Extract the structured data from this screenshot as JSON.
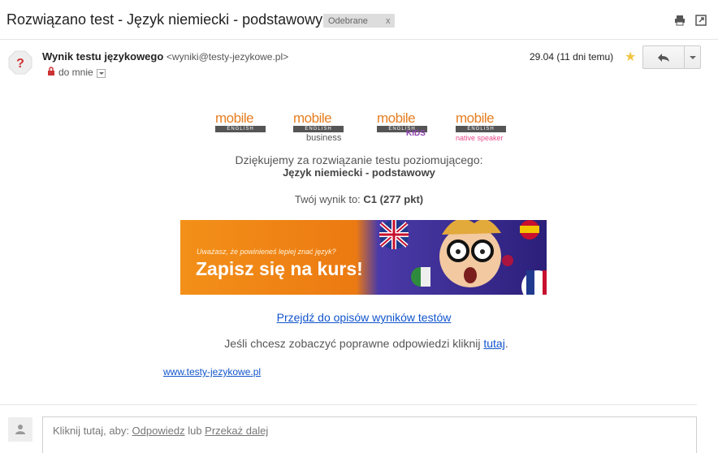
{
  "subject": "Rozwiązano test - Język niemiecki - podstawowy",
  "label": {
    "text": "Odebrane",
    "close": "x"
  },
  "icons": {
    "print": "print-icon",
    "popout": "new-window-icon",
    "avatar": "unknown-sender-icon",
    "lock": "lock-icon",
    "reply": "reply-arrow-icon",
    "star": "star-icon",
    "person": "person-icon"
  },
  "sender": {
    "name": "Wynik testu językowego",
    "email": "<wyniki@testy-jezykowe.pl>"
  },
  "recipient": {
    "text": "do mnie"
  },
  "date": "29.04 (11 dni temu)",
  "logos": [
    {
      "main": "mobile",
      "bar": "ENGLISH",
      "sub": ""
    },
    {
      "main": "mobile",
      "bar": "ENGLISH",
      "sub": "business"
    },
    {
      "main": "mobile",
      "bar": "ENGLISH",
      "sub": "KIDS"
    },
    {
      "main": "mobile",
      "bar": "ENGLISH",
      "sub": "native speaker"
    }
  ],
  "body": {
    "thanks": "Dziękujemy za rozwiązanie testu poziomującego:",
    "test_name": "Język niemiecki - podstawowy",
    "result_prefix": "Twój wynik to: ",
    "result_value": "C1 (277 pkt)",
    "banner_small": "Uważasz, że powinieneś lepiej znać język?",
    "banner_big": "Zapisz się na kurs!",
    "link_text": "Przejdź do opisów wyników testów",
    "answers_prefix": "Jeśli chcesz zobaczyć poprawne odpowiedzi kliknij ",
    "answers_link": "tutaj",
    "answers_suffix": ".",
    "site_link": "www.testy-jezykowe.pl"
  },
  "reply_box": {
    "prefix": "Kliknij tutaj, aby: ",
    "reply": "Odpowiedz",
    "middle": " lub ",
    "forward": "Przekaż dalej"
  },
  "colors": {
    "accent_link": "#1155cc",
    "orange": "#e67e22",
    "banner_purple": "#3b2d8f"
  }
}
